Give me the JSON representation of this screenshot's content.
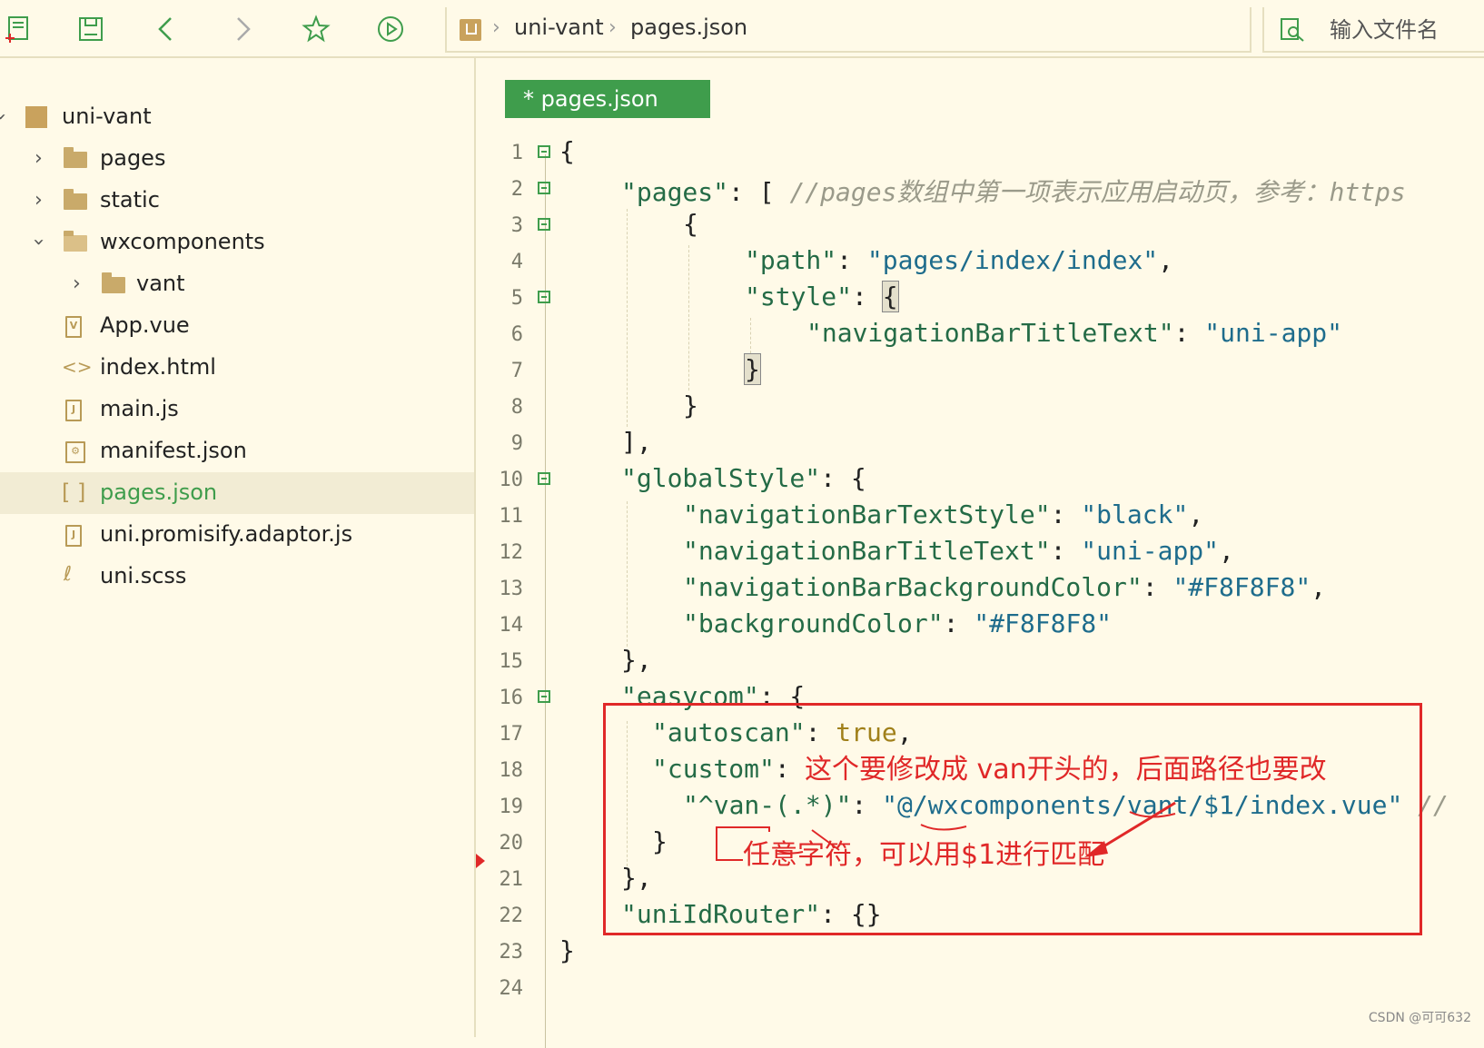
{
  "toolbar": {
    "breadcrumb": [
      "uni-vant",
      "pages.json"
    ],
    "search_placeholder": "输入文件名"
  },
  "sidebar": {
    "items": [
      {
        "label": "uni-vant",
        "icon": "project-icon"
      },
      {
        "label": "pages",
        "icon": "folder-icon"
      },
      {
        "label": "static",
        "icon": "folder-icon"
      },
      {
        "label": "wxcomponents",
        "icon": "folder-open-icon"
      },
      {
        "label": "vant",
        "icon": "folder-icon"
      },
      {
        "label": "App.vue",
        "icon": "vue-file-icon"
      },
      {
        "label": "index.html",
        "icon": "html-file-icon"
      },
      {
        "label": "main.js",
        "icon": "js-file-icon"
      },
      {
        "label": "manifest.json",
        "icon": "manifest-file-icon"
      },
      {
        "label": "pages.json",
        "icon": "json-file-icon"
      },
      {
        "label": "uni.promisify.adaptor.js",
        "icon": "js-file-icon"
      },
      {
        "label": "uni.scss",
        "icon": "scss-file-icon"
      }
    ]
  },
  "editor": {
    "tab_label": "* pages.json",
    "line_numbers": [
      "1",
      "2",
      "3",
      "4",
      "5",
      "6",
      "7",
      "8",
      "9",
      "10",
      "11",
      "12",
      "13",
      "14",
      "15",
      "16",
      "17",
      "18",
      "19",
      "20",
      "21",
      "22",
      "23",
      "24"
    ]
  },
  "code": {
    "l1": "{",
    "l2_key": "\"pages\"",
    "l2_rest": ": [ ",
    "l2_comment": "//pages数组中第一项表示应用启动页，参考：https",
    "l3": "{",
    "l4_key": "\"path\"",
    "l4_val": "\"pages/index/index\"",
    "l5_key": "\"style\"",
    "l6_key": "\"navigationBarTitleText\"",
    "l6_val": "\"uni-app\"",
    "l7": "}",
    "l8": "}",
    "l9": "],",
    "l10_key": "\"globalStyle\"",
    "l11_key": "\"navigationBarTextStyle\"",
    "l11_val": "\"black\"",
    "l12_key": "\"navigationBarTitleText\"",
    "l12_val": "\"uni-app\"",
    "l13_key": "\"navigationBarBackgroundColor\"",
    "l13_val": "\"#F8F8F8\"",
    "l14_key": "\"backgroundColor\"",
    "l14_val": "\"#F8F8F8\"",
    "l15": "},",
    "l16_key": "\"easycom\"",
    "l17_key": "\"autoscan\"",
    "l17_val": "true",
    "l18_key": "\"custom\"",
    "l19_key": "\"^van-(.*)\"",
    "l19_val": "\"@/wxcomponents/vant/$1/index.vue\"",
    "l19_comment": "//",
    "l20": "}",
    "l21": "},",
    "l22_key": "\"uniIdRouter\"",
    "l22_rest": ": {}",
    "l23": "}"
  },
  "annotations": {
    "note1": "这个要修改成 van开头的，后面路径也要改",
    "note2": "任意字符，可以用$1进行匹配"
  },
  "watermark": "CSDN @可可632",
  "colors": {
    "accent": "#3f9d4c",
    "annotation": "#e02828",
    "background": "#fffae8"
  }
}
